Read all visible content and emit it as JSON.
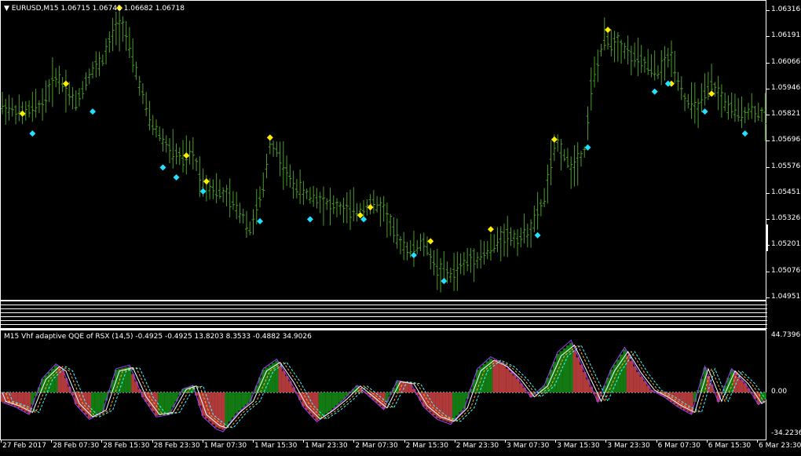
{
  "main_pane": {
    "symbol_header": "EURUSD,M15  1.06715 1.06741 1.06682 1.06718",
    "price_ticks": [
      "1.06316",
      "1.06191",
      "1.06066",
      "1.05946",
      "1.05821",
      "1.05696",
      "1.05576",
      "1.05451",
      "1.05326",
      "1.05201",
      "1.05076",
      "1.04951"
    ]
  },
  "indicator_pane": {
    "header": "M15 Vhf adaptive QQE of RSX (14,5) -0.4925 -0.4925 13.8203 8.3533 -0.4882 34.9026",
    "ticks": [
      "44.7396",
      "0.00",
      "-34.2236"
    ]
  },
  "time_axis": [
    "27 Feb 2017",
    "28 Feb 07:30",
    "28 Feb 15:30",
    "28 Feb 23:30",
    "1 Mar 07:30",
    "1 Mar 15:30",
    "1 Mar 23:30",
    "2 Mar 07:30",
    "2 Mar 15:30",
    "2 Mar 23:30",
    "3 Mar 07:30",
    "3 Mar 15:30",
    "3 Mar 23:30",
    "6 Mar 07:30",
    "6 Mar 15:30",
    "6 Mar 23:30"
  ],
  "colors": {
    "bar": "#4a9e2a",
    "yellow_marker": "#ffee00",
    "cyan_marker": "#22e0ff",
    "hist_green": "#137a13",
    "hist_red": "#b03a3a",
    "line_purple": "#a040ff",
    "line_white": "#ffffff",
    "line_cyan": "#40ffff",
    "line_orange": "#ffb030"
  },
  "chart_data": [
    {
      "type": "ohlc",
      "title": "EURUSD,M15",
      "y_range": [
        1.049,
        1.064
      ],
      "yellow_markers": [
        [
          6,
          1.0583
        ],
        [
          19,
          1.0598
        ],
        [
          35,
          1.0636
        ],
        [
          55,
          1.0562
        ],
        [
          61,
          1.0549
        ],
        [
          80,
          1.0571
        ],
        [
          107,
          1.0532
        ],
        [
          110,
          1.0536
        ],
        [
          128,
          1.0519
        ],
        [
          146,
          1.0525
        ],
        [
          165,
          1.057
        ],
        [
          181,
          1.0625
        ],
        [
          200,
          1.0598
        ],
        [
          212,
          1.0593
        ]
      ],
      "cyan_markers": [
        [
          9,
          1.0573
        ],
        [
          27,
          1.0584
        ],
        [
          48,
          1.0556
        ],
        [
          52,
          1.0551
        ],
        [
          60,
          1.0544
        ],
        [
          77,
          1.0529
        ],
        [
          92,
          1.053
        ],
        [
          108,
          1.053
        ],
        [
          123,
          1.0512
        ],
        [
          132,
          1.0499
        ],
        [
          160,
          1.0522
        ],
        [
          175,
          1.0566
        ],
        [
          195,
          1.0594
        ],
        [
          199,
          1.0598
        ],
        [
          210,
          1.0584
        ],
        [
          222,
          1.0573
        ]
      ]
    },
    {
      "type": "area",
      "title": "M15 Vhf adaptive QQE of RSX (14,5)",
      "y_range": [
        -34.2236,
        44.7396
      ]
    }
  ]
}
